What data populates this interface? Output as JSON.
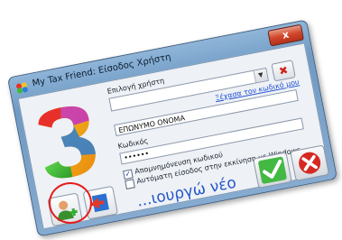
{
  "window": {
    "title": "My Tax Friend: Είσοδος Χρήστη",
    "close_label": "x"
  },
  "form": {
    "user_select_label": "Επιλογή χρήστη",
    "user_select_value": "",
    "name_value": "ΕΠΩΝΥΜΟ ΟΝΟΜΑ",
    "forgot_link": "Ξέχασα τον κωδικό μου",
    "password_label": "Κωδικός",
    "password_value": "••••••",
    "remember_password_label": "Απομνημόνευση κωδικού",
    "remember_password_checked": true,
    "auto_login_label": "Αυτόματη είσοδος στην εκκίνηση με Windows",
    "auto_login_checked": false
  },
  "logo": {
    "digit": "3",
    "colors": [
      "#e8302a",
      "#f6c21c",
      "#3dbb34",
      "#2c7fd6",
      "#c02ad0"
    ]
  },
  "icons": {
    "new_user": "add-user-icon",
    "exit": "exit-icon",
    "ok": "checkmark-icon",
    "cancel": "cancel-icon",
    "delete": "delete-x-icon"
  },
  "annotation": {
    "caption": "...ιουργώ νέο",
    "highlight_color": "#e21d1d",
    "caption_color": "#2457c9"
  }
}
